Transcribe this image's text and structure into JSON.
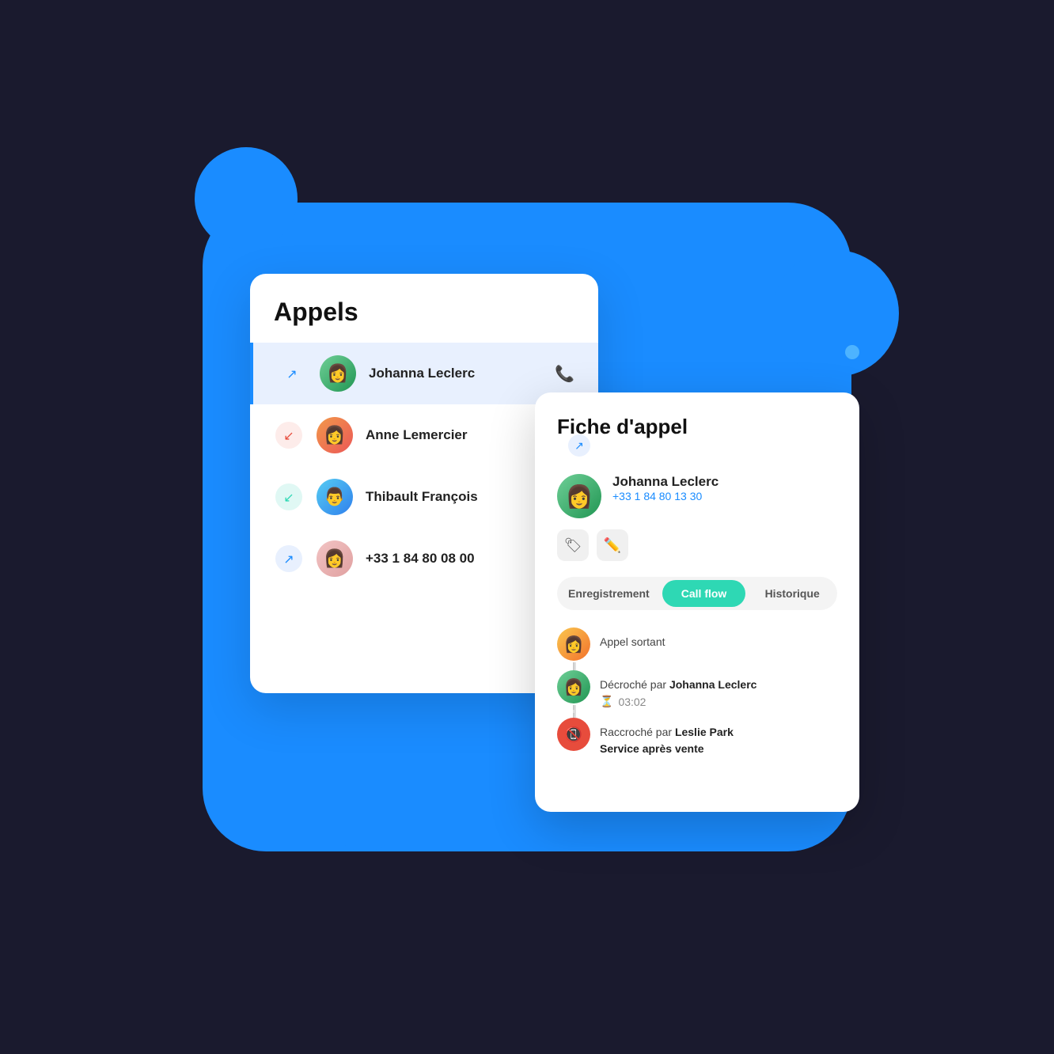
{
  "background": {
    "color": "#1a8cff"
  },
  "calls_panel": {
    "title": "Appels",
    "items": [
      {
        "id": "johanna",
        "name": "Johanna Leclerc",
        "icon_type": "outgoing",
        "icon_color": "#1a8cff",
        "active": true
      },
      {
        "id": "anne",
        "name": "Anne Lemercier",
        "icon_type": "incoming-missed",
        "icon_color": "#e74c3c",
        "active": false
      },
      {
        "id": "thibault",
        "name": "Thibault François",
        "icon_type": "incoming",
        "icon_color": "#2ed8b4",
        "active": false
      },
      {
        "id": "unknown",
        "name": "+33 1 84 80 08 00",
        "icon_type": "outgoing",
        "icon_color": "#1a8cff",
        "active": false
      }
    ]
  },
  "fiche_panel": {
    "title": "Fiche d'appel",
    "contact": {
      "name": "Johanna Leclerc",
      "phone": "+33 1 84 80 13 30"
    },
    "tabs": [
      {
        "id": "enregistrement",
        "label": "Enregistrement",
        "active": false
      },
      {
        "id": "callflow",
        "label": "Call flow",
        "active": true
      },
      {
        "id": "historique",
        "label": "Historique",
        "active": false
      }
    ],
    "timeline": [
      {
        "id": "outgoing",
        "type": "outgoing",
        "text": "Appel sortant",
        "bold_parts": []
      },
      {
        "id": "answered",
        "type": "answered",
        "text": "Décroché par Johanna Leclerc",
        "bold_name": "Johanna Leclerc",
        "duration": "03:02"
      },
      {
        "id": "hangup",
        "type": "hangup",
        "text": "Raccroché par Leslie Park",
        "bold_name": "Leslie Park",
        "subtitle": "Service après vente"
      }
    ],
    "action_tag_icon": "🏷",
    "action_edit_icon": "✏"
  }
}
